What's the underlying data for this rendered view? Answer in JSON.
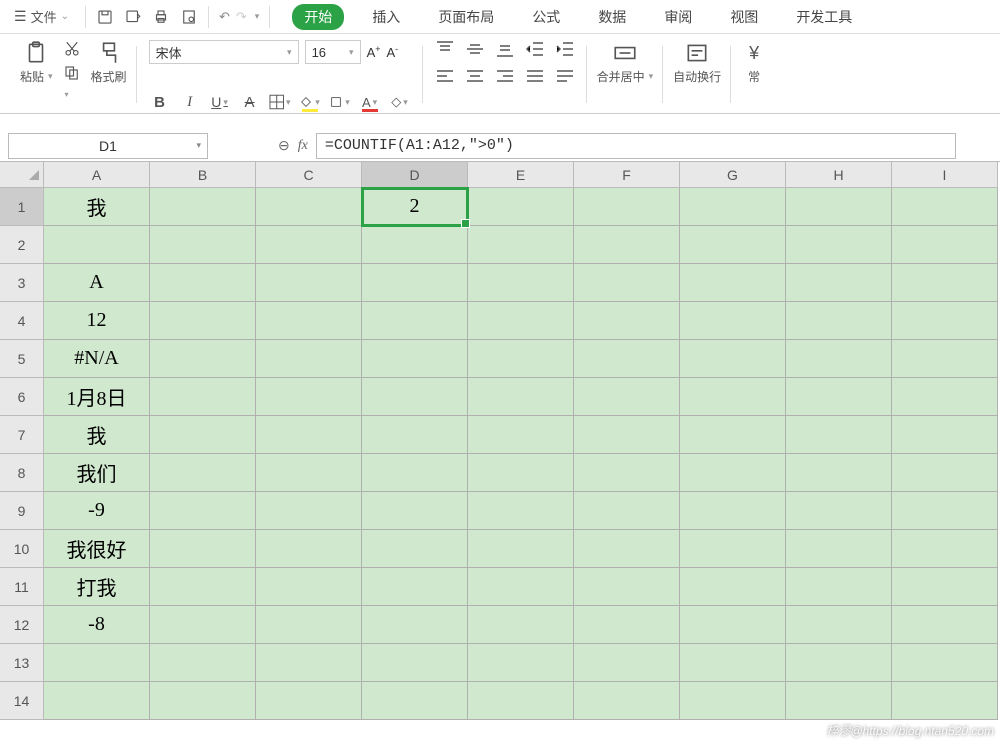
{
  "menu": {
    "file": "文件",
    "tabs": [
      "开始",
      "插入",
      "页面布局",
      "公式",
      "数据",
      "审阅",
      "视图",
      "开发工具"
    ],
    "active_tab": 0
  },
  "ribbon": {
    "paste": "粘贴",
    "format_painter": "格式刷",
    "font_name": "宋体",
    "font_size": "16",
    "merge_center": "合并居中",
    "auto_wrap": "自动换行",
    "more": "常"
  },
  "name_box": "D1",
  "formula": "=COUNTIF(A1:A12,\">0\")",
  "columns": [
    "A",
    "B",
    "C",
    "D",
    "E",
    "F",
    "G",
    "H",
    "I"
  ],
  "selected_col_index": 3,
  "selected_row_index": 0,
  "rows": [
    {
      "n": "1",
      "cells": [
        "我",
        "",
        "",
        "2",
        "",
        "",
        "",
        "",
        ""
      ]
    },
    {
      "n": "2",
      "cells": [
        "",
        "",
        "",
        "",
        "",
        "",
        "",
        "",
        ""
      ]
    },
    {
      "n": "3",
      "cells": [
        "A",
        "",
        "",
        "",
        "",
        "",
        "",
        "",
        ""
      ]
    },
    {
      "n": "4",
      "cells": [
        "12",
        "",
        "",
        "",
        "",
        "",
        "",
        "",
        ""
      ]
    },
    {
      "n": "5",
      "cells": [
        "#N/A",
        "",
        "",
        "",
        "",
        "",
        "",
        "",
        ""
      ]
    },
    {
      "n": "6",
      "cells": [
        "1月8日",
        "",
        "",
        "",
        "",
        "",
        "",
        "",
        ""
      ]
    },
    {
      "n": "7",
      "cells": [
        "我",
        "",
        "",
        "",
        "",
        "",
        "",
        "",
        ""
      ]
    },
    {
      "n": "8",
      "cells": [
        "我们",
        "",
        "",
        "",
        "",
        "",
        "",
        "",
        ""
      ]
    },
    {
      "n": "9",
      "cells": [
        "-9",
        "",
        "",
        "",
        "",
        "",
        "",
        "",
        ""
      ]
    },
    {
      "n": "10",
      "cells": [
        "我很好",
        "",
        "",
        "",
        "",
        "",
        "",
        "",
        ""
      ]
    },
    {
      "n": "11",
      "cells": [
        "打我",
        "",
        "",
        "",
        "",
        "",
        "",
        "",
        ""
      ]
    },
    {
      "n": "12",
      "cells": [
        "-8",
        "",
        "",
        "",
        "",
        "",
        "",
        "",
        ""
      ]
    },
    {
      "n": "13",
      "cells": [
        "",
        "",
        "",
        "",
        "",
        "",
        "",
        "",
        ""
      ]
    },
    {
      "n": "14",
      "cells": [
        "",
        "",
        "",
        "",
        "",
        "",
        "",
        "",
        ""
      ]
    }
  ],
  "watermark": "椊漻@https://blog.ntan520.com",
  "colors": {
    "accent": "#2ba246",
    "cell_bg": "#d0e8ce"
  }
}
